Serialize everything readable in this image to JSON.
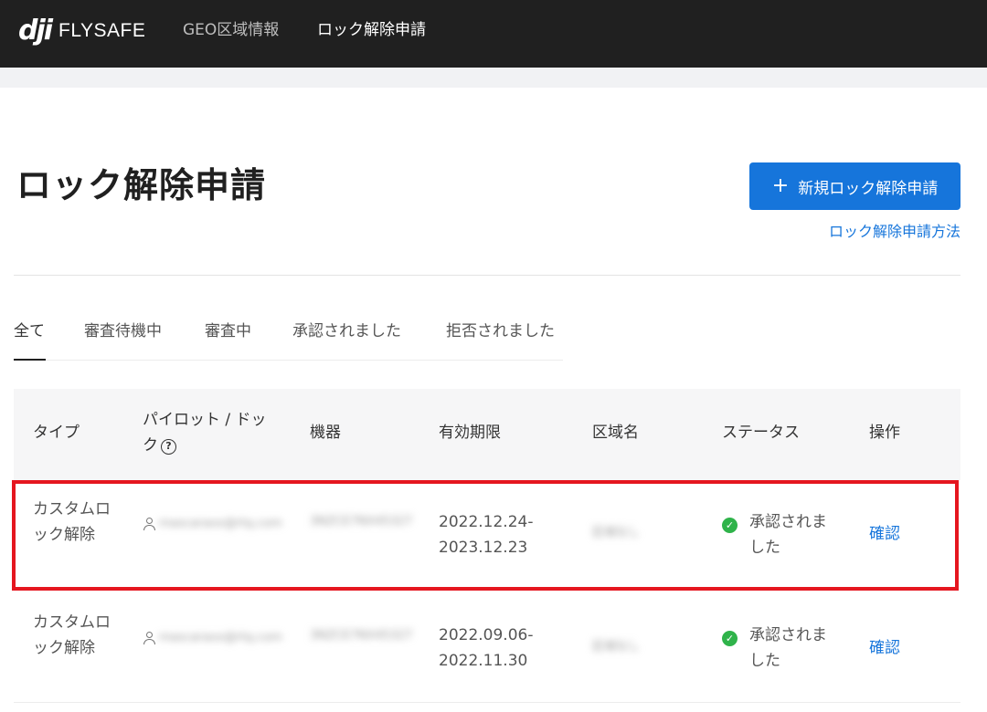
{
  "nav": {
    "brand": "FLYSAFE",
    "items": [
      "GEO区域情報",
      "ロック解除申請"
    ]
  },
  "header": {
    "title": "ロック解除申請",
    "new_button": "新規ロック解除申請",
    "howto_link": "ロック解除申請方法"
  },
  "tabs": [
    "全て",
    "審査待機中",
    "審査中",
    "承認されました",
    "拒否されました"
  ],
  "table": {
    "columns": [
      "タイプ",
      "パイロット / ドック",
      "機器",
      "有効期限",
      "区域名",
      "ステータス",
      "操作"
    ],
    "rows": [
      {
        "type": "カスタムロック解除",
        "pilot": "mascaraxx@rtq.com",
        "device": "3NZCE7NX45327",
        "validity": [
          "2022.12.24-",
          "2023.12.23"
        ],
        "area": "区域なし",
        "status": "承認されました",
        "action": "確認"
      },
      {
        "type": "カスタムロック解除",
        "pilot": "mascaraxx@rtq.com",
        "device": "3NZCE7NX45327",
        "validity": [
          "2022.09.06-",
          "2022.11.30"
        ],
        "area": "区域なし",
        "status": "承認されました",
        "action": "確認"
      }
    ]
  },
  "colors": {
    "accent": "#1675db",
    "topbar": "#202020",
    "success": "#2fb34a",
    "highlight": "#e5161f"
  },
  "icons": [
    "dji-logo",
    "plus-icon",
    "help-icon",
    "user-icon",
    "check-circle-icon"
  ]
}
